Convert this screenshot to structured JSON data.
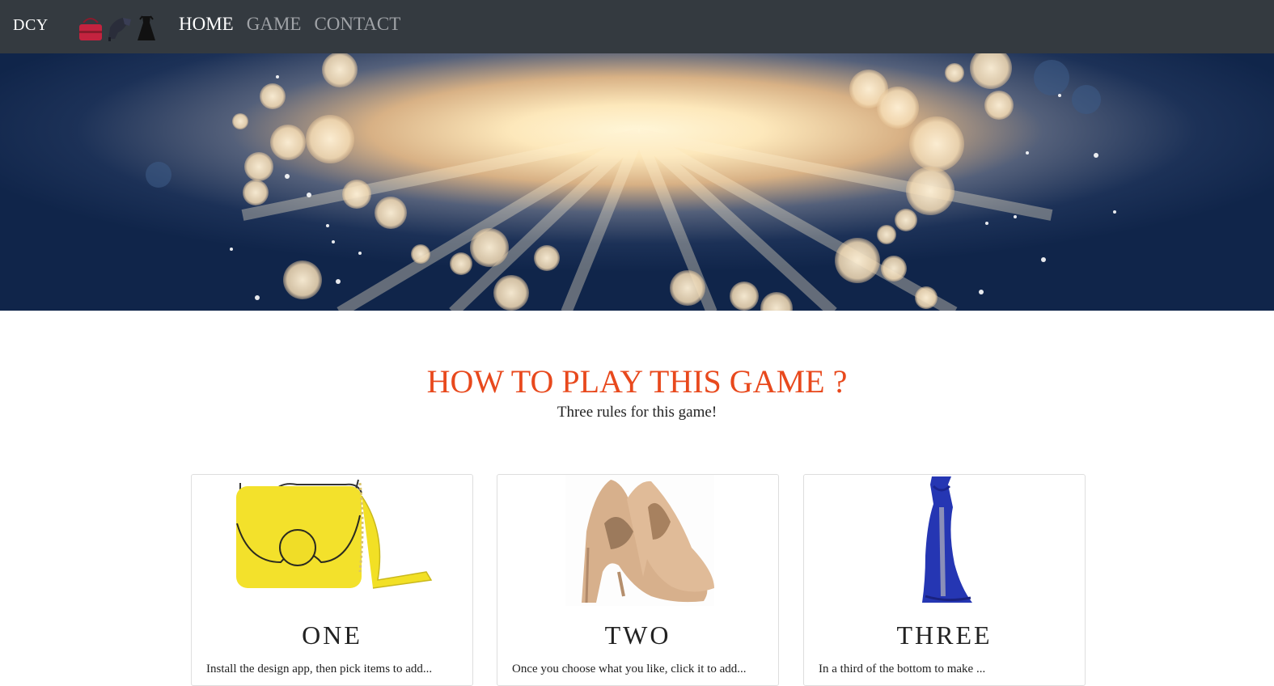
{
  "navbar": {
    "brand": "DCY",
    "icons": [
      "handbag-icon",
      "high-heel-icon",
      "dress-icon"
    ],
    "links": [
      {
        "label": "HOME",
        "active": true
      },
      {
        "label": "GAME",
        "active": false
      },
      {
        "label": "CONTACT",
        "active": false
      }
    ]
  },
  "colors": {
    "navbar_bg": "#343a40",
    "title_accent": "#e8491d",
    "hero_bg": "#152a4d"
  },
  "section": {
    "title": "HOW TO PLAY THIS GAME ?",
    "subtitle": "Three rules for this game!"
  },
  "cards": [
    {
      "title": "ONE",
      "image": "yellow-handbag-image",
      "text": "Install the design app, then pick items to add..."
    },
    {
      "title": "TWO",
      "image": "beige-high-heels-image",
      "text": "Once you choose what you like, click it to add..."
    },
    {
      "title": "THREE",
      "image": "blue-gown-image",
      "text": "In a third of the bottom to make ..."
    }
  ]
}
